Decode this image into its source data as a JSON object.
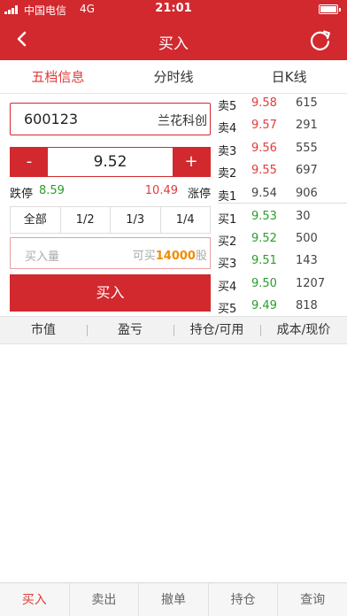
{
  "status": {
    "carrier": "中国电信",
    "network": "4G",
    "time": "21:01"
  },
  "nav": {
    "title": "买入"
  },
  "tabs": [
    {
      "label": "五档信息",
      "active": true
    },
    {
      "label": "分时线",
      "active": false
    },
    {
      "label": "日K线",
      "active": false
    }
  ],
  "trade": {
    "code": "600123",
    "name": "兰花科创",
    "minus": "-",
    "plus": "+",
    "price": "9.52",
    "limit_down_label": "跌停",
    "limit_down": "8.59",
    "limit_up": "10.49",
    "limit_up_label": "涨停",
    "ratios": [
      "全部",
      "1/2",
      "1/3",
      "1/4"
    ],
    "qty_placeholder": "买入量",
    "avail_prefix": "可买",
    "avail_num": "14000",
    "avail_suffix": "股",
    "buy_label": "买入"
  },
  "book": {
    "asks": [
      {
        "label": "卖5",
        "price": "9.58",
        "vol": "615",
        "color": "red"
      },
      {
        "label": "卖4",
        "price": "9.57",
        "vol": "291",
        "color": "red"
      },
      {
        "label": "卖3",
        "price": "9.56",
        "vol": "555",
        "color": "red"
      },
      {
        "label": "卖2",
        "price": "9.55",
        "vol": "697",
        "color": "red"
      },
      {
        "label": "卖1",
        "price": "9.54",
        "vol": "906",
        "color": "gray"
      }
    ],
    "bids": [
      {
        "label": "买1",
        "price": "9.53",
        "vol": "30",
        "color": "green"
      },
      {
        "label": "买2",
        "price": "9.52",
        "vol": "500",
        "color": "green"
      },
      {
        "label": "买3",
        "price": "9.51",
        "vol": "143",
        "color": "green"
      },
      {
        "label": "买4",
        "price": "9.50",
        "vol": "1207",
        "color": "green"
      },
      {
        "label": "买5",
        "price": "9.49",
        "vol": "818",
        "color": "green"
      }
    ]
  },
  "holdings": {
    "columns": [
      "市值",
      "盈亏",
      "持仓/可用",
      "成本/现价"
    ]
  },
  "bottom_nav": [
    {
      "label": "买入",
      "active": true
    },
    {
      "label": "卖出",
      "active": false
    },
    {
      "label": "撤单",
      "active": false
    },
    {
      "label": "持仓",
      "active": false
    },
    {
      "label": "查询",
      "active": false
    }
  ],
  "colors": {
    "brand": "#d1292e",
    "up": "#e23a3a",
    "down": "#2a9d2a",
    "highlight": "#f08c00"
  }
}
